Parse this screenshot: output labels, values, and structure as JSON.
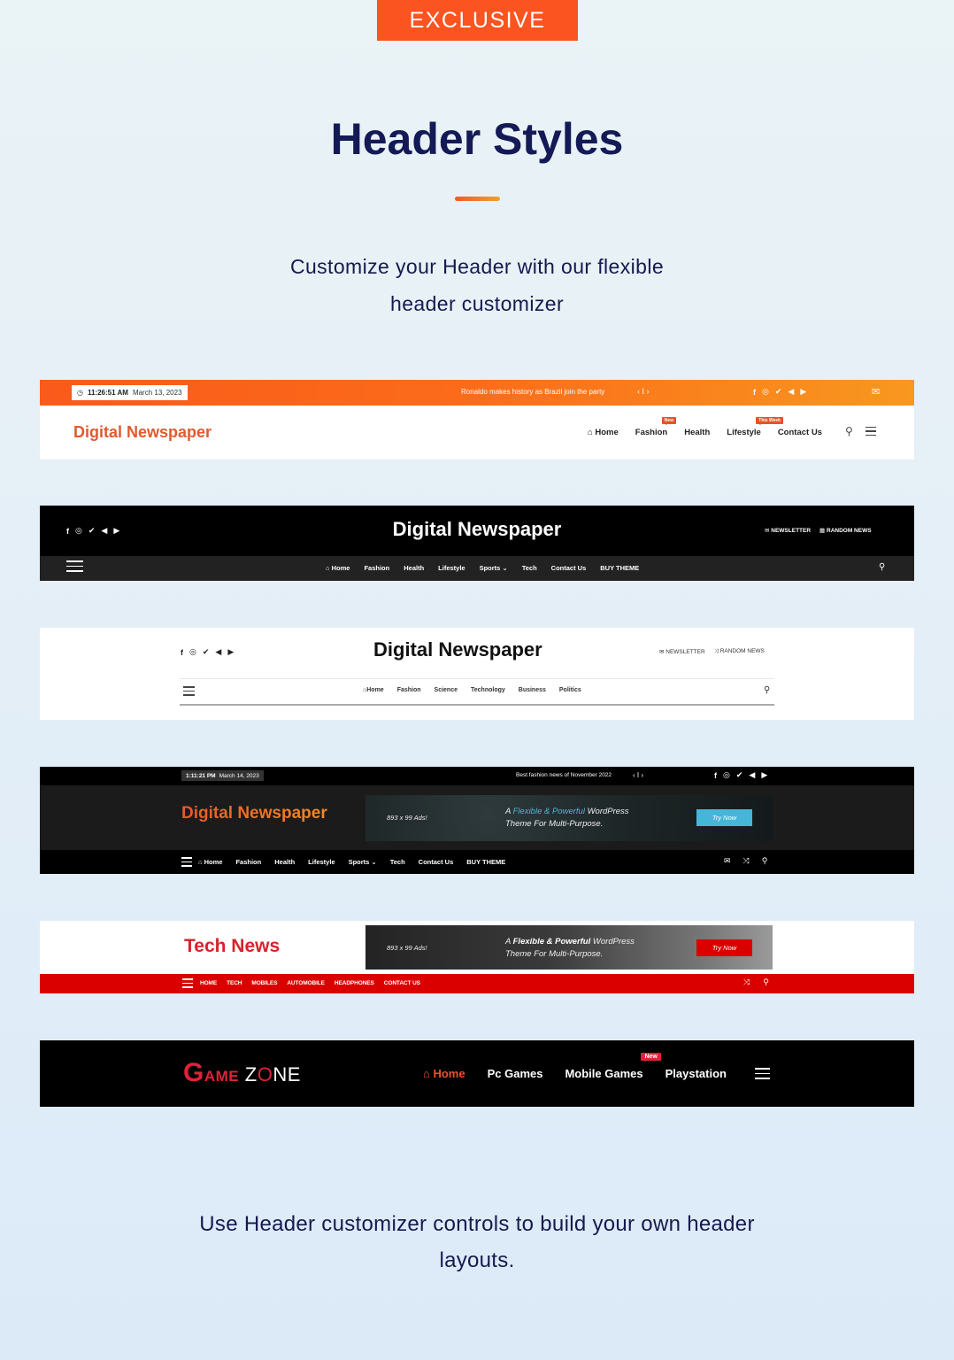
{
  "intro": {
    "badge": "EXCLUSIVE",
    "title": "Header Styles",
    "subtitle_line1": "Customize your Header with our flexible",
    "subtitle_line2": "header customizer",
    "footer_line1": "Use Header customizer controls to build your own header",
    "footer_line2": "layouts.",
    "accent_color": "#fb5420"
  },
  "social_icons": [
    "f",
    "◎",
    "🐦",
    "◀",
    "▶"
  ],
  "header1": {
    "time": "11:26:51 AM",
    "date": "March 13, 2023",
    "ticker": "Ronaldo makes history as Brazil join the party",
    "ticker_nav": "‹ I ›",
    "logo": "Digital Newspaper",
    "nav": [
      {
        "label": "Home",
        "icon": "home-icon"
      },
      {
        "label": "Fashion",
        "badge": "New"
      },
      {
        "label": "Health"
      },
      {
        "label": "Lifestyle",
        "badge": "This Week"
      },
      {
        "label": "Contact Us"
      }
    ]
  },
  "header2": {
    "logo": "Digital Newspaper",
    "newsletter": "NEWSLETTER",
    "random_news": "RANDOM NEWS",
    "nav": [
      "Home",
      "Fashion",
      "Health",
      "Lifestyle",
      "Sports ⌄",
      "Tech",
      "Contact Us",
      "BUY THEME"
    ]
  },
  "header3": {
    "logo": "Digital Newspaper",
    "newsletter": "NEWSLETTER",
    "random_news": "RANDOM NEWS",
    "nav": [
      "Home",
      "Fashion",
      "Science",
      "Technology",
      "Business",
      "Politics"
    ]
  },
  "header4": {
    "time": "1:11:21 PM",
    "date": "March 14, 2023",
    "ticker": "Best fashion news of November 2022",
    "ticker_nav": "‹ I ›",
    "logo": "Digital Newspaper",
    "ad": {
      "size": "893 x 99 Ads!",
      "pitch_prefix": "A ",
      "pitch_highlight": "Flexible & Powerful",
      "pitch_suffix": " WordPress",
      "pitch_line2": "Theme For Multi-Purpose.",
      "cta": "Try Now",
      "cta_color": "#45b6d7"
    },
    "nav": [
      "Home",
      "Fashion",
      "Health",
      "Lifestyle",
      "Sports ⌄",
      "Tech",
      "Contact Us",
      "BUY THEME"
    ]
  },
  "header5": {
    "logo": "Tech News",
    "ad": {
      "size": "893 x 99 Ads!",
      "pitch_prefix": "A ",
      "pitch_highlight": "Flexible & Powerful",
      "pitch_suffix": " WordPress",
      "pitch_line2": "Theme For Multi-Purpose.",
      "cta": "Try Now",
      "cta_color": "#db0000"
    },
    "nav": [
      "HOME",
      "TECH",
      "MOBILES",
      "AUTOMOBILE",
      "HEADPHONES",
      "CONTACT US"
    ]
  },
  "header6": {
    "logo_g": "G",
    "logo_ame": "AME",
    "logo_z": "Z",
    "logo_o": "O",
    "logo_ne": "NE",
    "nav": [
      {
        "label": "Home",
        "active": true
      },
      {
        "label": "Pc Games"
      },
      {
        "label": "Mobile Games",
        "badge": "New"
      },
      {
        "label": "Playstation"
      }
    ]
  }
}
